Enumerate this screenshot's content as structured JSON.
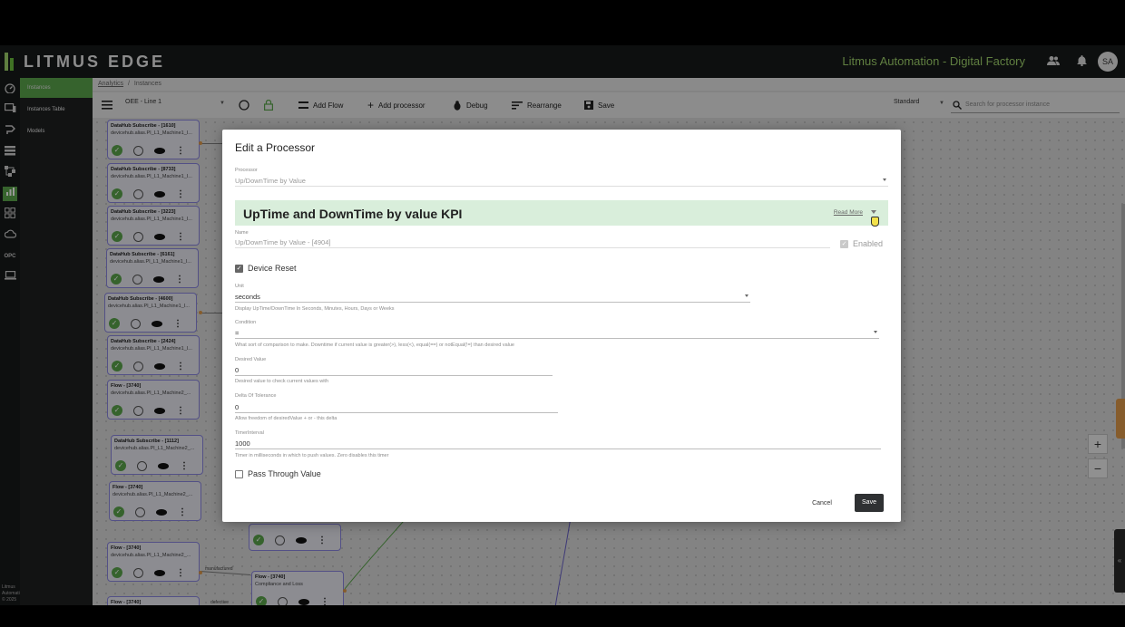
{
  "app": {
    "logo_text": "LITMUS EDGE",
    "company": "Litmus Automation - Digital Factory",
    "avatar_initials": "SA",
    "copyright": "Litmus Automation © 2025"
  },
  "rail_icons": [
    "dashboard-icon",
    "devices-icon",
    "integration-icon",
    "datahub-icon",
    "flows-icon",
    "analytics-icon",
    "apps-icon",
    "cloud-icon",
    "opc-icon",
    "system-icon"
  ],
  "rail_opc_label": "OPC",
  "submenu": {
    "items": [
      "Instances",
      "Instances Table",
      "Models"
    ],
    "active": "Instances"
  },
  "breadcrumb": {
    "parent": "Analytics",
    "separator": "/",
    "current": "Instances"
  },
  "toolbar": {
    "group_select": "OEE - Line 1",
    "add_flow": "Add Flow",
    "add_processor": "Add processor",
    "debug": "Debug",
    "rearrange": "Rearrange",
    "save": "Save",
    "view_select": "Standard",
    "search_placeholder": "Search for processor instance"
  },
  "canvas": {
    "nodes": [
      {
        "title": "DataHub Subscribe - [1610]",
        "subtitle": "devicehub.alias.PI_L1_Machine1_I..."
      },
      {
        "title": "DataHub Subscribe - [8733]",
        "subtitle": "devicehub.alias.PI_L1_Machine1_I..."
      },
      {
        "title": "DataHub Subscribe - [3223]",
        "subtitle": "devicehub.alias.PI_L1_Machine1_I..."
      },
      {
        "title": "DataHub Subscribe - [6161]",
        "subtitle": "devicehub.alias.PI_L1_Machine1_I..."
      },
      {
        "title": "DataHub Subscribe - [4600]",
        "subtitle": "devicehub.alias.PI_L1_Machine1_I..."
      },
      {
        "title": "DataHub Subscribe - [2424]",
        "subtitle": "devicehub.alias.PI_L1_Machine1_I..."
      },
      {
        "title": "Flow - [3740]",
        "subtitle": "devicehub.alias.PI_L1_Machine2_..."
      },
      {
        "title": "DataHub Subscribe - [1112]",
        "subtitle": "devicehub.alias.PI_L1_Machine2_..."
      },
      {
        "title": "Flow - [3740]",
        "subtitle": "devicehub.alias.PI_L1_Machine2_..."
      },
      {
        "title": "Flow - [3740]",
        "subtitle": "devicehub.alias.PI_L1_Machine2_..."
      },
      {
        "title": "Flow - [3740]",
        "subtitle": "Compliance and Loss"
      },
      {
        "title": "Flow - [3740]",
        "subtitle": ""
      }
    ],
    "wire_labels": [
      "manufactured",
      "defective"
    ]
  },
  "modal": {
    "title": "Edit a Processor",
    "processor_label": "Processor",
    "processor_value": "Up/DownTime by Value",
    "banner_title": "UpTime and DownTime by value KPI",
    "read_more": "Read More",
    "name_label": "Name",
    "name_value": "Up/DownTime by Value - [4904]",
    "enabled_label": "Enabled",
    "enabled": true,
    "device_reset_label": "Device Reset",
    "device_reset": true,
    "unit_label": "Unit",
    "unit_value": "seconds",
    "unit_hint": "Display UpTime/DownTime In Seconds, Minutes, Hours, Days or Weeks",
    "condition_label": "Condition",
    "condition_value": "=",
    "condition_hint": "What sort of comparison to make. Downtime if current value is greater(>), less(<), equal(==) or notEqual(!=) than desired value",
    "desired_label": "Desired Value",
    "desired_value": "0",
    "desired_hint": "Desired value to check current values with",
    "delta_label": "Delta Of Tolerance",
    "delta_value": "0",
    "delta_hint": "Allow freedom of desiredValue + or - this delta",
    "timer_label": "TimerInterval",
    "timer_value": "1000",
    "timer_hint": "Timer in milliseconds in which to push values. Zero disables this timer",
    "pass_through_label": "Pass Through Value",
    "pass_through": false,
    "cancel": "Cancel",
    "save": "Save"
  },
  "zoom": {
    "plus": "+",
    "minus": "−"
  },
  "colors": {
    "brand_green": "#5aa64b",
    "banner_bg": "#d9eedb",
    "node_border": "#8a86e0",
    "header_bg": "#17191a"
  }
}
